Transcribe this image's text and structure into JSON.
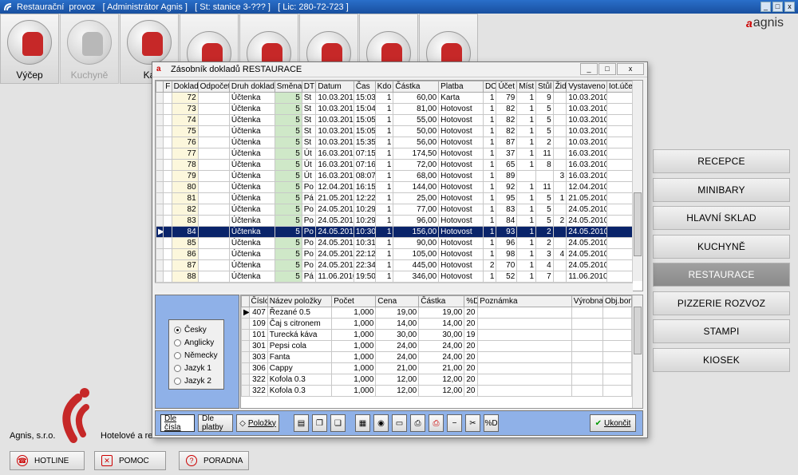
{
  "window": {
    "title": "Restaurační  provoz   [ Administrátor Agnis ]   [ St: stanice 3-??? ]   [ Lic: 280-72-723 ]",
    "btn_min": "_",
    "btn_max": "□",
    "btn_close": "x"
  },
  "brand": {
    "name": "agnis",
    "mark": "a"
  },
  "toolbar": [
    {
      "label": "Výčep",
      "name": "vycep",
      "dim": false
    },
    {
      "label": "Kuchyně",
      "name": "kuchyne",
      "dim": true
    },
    {
      "label": "Ka",
      "name": "kasa",
      "dim": false
    },
    {
      "label": "",
      "name": "sklad",
      "dim": false
    },
    {
      "label": "",
      "name": "tool5",
      "dim": false
    },
    {
      "label": "",
      "name": "tool6",
      "dim": false
    },
    {
      "label": "",
      "name": "tool7",
      "dim": false
    },
    {
      "label": "",
      "name": "tool8",
      "dim": false
    }
  ],
  "rightmenu": [
    {
      "label": "RECEPCE",
      "selected": false
    },
    {
      "label": "MINIBARY",
      "selected": false
    },
    {
      "label": "HLAVNÍ SKLAD",
      "selected": false
    },
    {
      "label": "KUCHYNĚ",
      "selected": false
    },
    {
      "label": "RESTAURACE",
      "selected": true
    },
    {
      "label": "PIZZERIE ROZVOZ",
      "selected": false
    },
    {
      "label": "STAMPI",
      "selected": false
    },
    {
      "label": "KIOSEK",
      "selected": false
    }
  ],
  "footer": {
    "company": "Agnis, s.r.o.",
    "tagline": "Hotelové a re",
    "hotline": "HOTLINE",
    "pomoc": "POMOC",
    "poradna": "PORADNA"
  },
  "dialog": {
    "title": "Zásobník dokladů  RESTAURACE",
    "columns": [
      "F",
      "Doklad",
      "Odpočet",
      "Druh dokladu",
      "Směna",
      "DT",
      "Datum",
      "Čas",
      "Kdo",
      "Částka",
      "Platba",
      "DC",
      "Účet",
      "Míst",
      "Stůl",
      "Žid",
      "Vystaveno",
      "Iot.účet"
    ],
    "rows": [
      [
        "",
        "72",
        "",
        "Účtenka",
        "5",
        "St",
        "10.03.2010",
        "15:03",
        "1",
        "60,00",
        "Karta",
        "1",
        "79",
        "1",
        "9",
        "",
        "10.03.2010",
        ""
      ],
      [
        "",
        "73",
        "",
        "Účtenka",
        "5",
        "St",
        "10.03.2010",
        "15:04",
        "1",
        "81,00",
        "Hotovost",
        "1",
        "82",
        "1",
        "5",
        "",
        "10.03.2010",
        ""
      ],
      [
        "",
        "74",
        "",
        "Účtenka",
        "5",
        "St",
        "10.03.2010",
        "15:05",
        "1",
        "55,00",
        "Hotovost",
        "1",
        "82",
        "1",
        "5",
        "",
        "10.03.2010",
        ""
      ],
      [
        "",
        "75",
        "",
        "Účtenka",
        "5",
        "St",
        "10.03.2010",
        "15:05",
        "1",
        "50,00",
        "Hotovost",
        "1",
        "82",
        "1",
        "5",
        "",
        "10.03.2010",
        ""
      ],
      [
        "",
        "76",
        "",
        "Účtenka",
        "5",
        "St",
        "10.03.2010",
        "15:35",
        "1",
        "56,00",
        "Hotovost",
        "1",
        "87",
        "1",
        "2",
        "",
        "10.03.2010",
        ""
      ],
      [
        "",
        "77",
        "",
        "Účtenka",
        "5",
        "Út",
        "16.03.2010",
        "07:15",
        "1",
        "174,50",
        "Hotovost",
        "1",
        "37",
        "1",
        "11",
        "",
        "16.03.2010",
        ""
      ],
      [
        "",
        "78",
        "",
        "Účtenka",
        "5",
        "Út",
        "16.03.2010",
        "07:16",
        "1",
        "72,00",
        "Hotovost",
        "1",
        "65",
        "1",
        "8",
        "",
        "16.03.2010",
        ""
      ],
      [
        "",
        "79",
        "",
        "Účtenka",
        "5",
        "Út",
        "16.03.2010",
        "08:07",
        "1",
        "68,00",
        "Hotovost",
        "1",
        "89",
        "",
        "",
        "3",
        "16.03.2010",
        ""
      ],
      [
        "",
        "80",
        "",
        "Účtenka",
        "5",
        "Po",
        "12.04.2010",
        "16:15",
        "1",
        "144,00",
        "Hotovost",
        "1",
        "92",
        "1",
        "11",
        "",
        "12.04.2010",
        ""
      ],
      [
        "",
        "81",
        "",
        "Účtenka",
        "5",
        "Pá",
        "21.05.2010",
        "12:22",
        "1",
        "25,00",
        "Hotovost",
        "1",
        "95",
        "1",
        "5",
        "1",
        "21.05.2010",
        ""
      ],
      [
        "",
        "82",
        "",
        "Účtenka",
        "5",
        "Po",
        "24.05.2010",
        "10:29",
        "1",
        "77,00",
        "Hotovost",
        "1",
        "83",
        "1",
        "5",
        "",
        "24.05.2010",
        ""
      ],
      [
        "",
        "83",
        "",
        "Účtenka",
        "5",
        "Po",
        "24.05.2010",
        "10:29",
        "1",
        "96,00",
        "Hotovost",
        "1",
        "84",
        "1",
        "5",
        "2",
        "24.05.2010",
        ""
      ],
      [
        "",
        "84",
        "",
        "Účtenka",
        "5",
        "Po",
        "24.05.2010",
        "10:30",
        "1",
        "156,00",
        "Hotovost",
        "1",
        "93",
        "1",
        "2",
        "",
        "24.05.2010",
        ""
      ],
      [
        "",
        "85",
        "",
        "Účtenka",
        "5",
        "Po",
        "24.05.2010",
        "10:31",
        "1",
        "90,00",
        "Hotovost",
        "1",
        "96",
        "1",
        "2",
        "",
        "24.05.2010",
        ""
      ],
      [
        "",
        "86",
        "",
        "Účtenka",
        "5",
        "Po",
        "24.05.2010",
        "22:12",
        "1",
        "105,00",
        "Hotovost",
        "1",
        "98",
        "1",
        "3",
        "4",
        "24.05.2010",
        ""
      ],
      [
        "",
        "87",
        "",
        "Účtenka",
        "5",
        "Po",
        "24.05.2010",
        "22:34",
        "1",
        "445,00",
        "Hotovost",
        "2",
        "70",
        "1",
        "4",
        "",
        "24.05.2010",
        ""
      ],
      [
        "",
        "88",
        "",
        "Účtenka",
        "5",
        "Pá",
        "11.06.2010",
        "19:50",
        "1",
        "346,00",
        "Hotovost",
        "1",
        "52",
        "1",
        "7",
        "",
        "11.06.2010",
        ""
      ]
    ],
    "selected_row": "84",
    "languages": [
      {
        "label": "Česky",
        "checked": true
      },
      {
        "label": "Anglicky",
        "checked": false
      },
      {
        "label": "Německy",
        "checked": false
      },
      {
        "label": "Jazyk 1",
        "checked": false
      },
      {
        "label": "Jazyk 2",
        "checked": false
      }
    ],
    "items_columns": [
      "Číslo",
      "Název položky",
      "Počet",
      "Cena",
      "Částka",
      "%D",
      "Poznámka",
      "Výrobna",
      "Obj.bon"
    ],
    "items": [
      [
        "407",
        "Řezané 0.5",
        "1,000",
        "19,00",
        "19,00",
        "20",
        "",
        "",
        ""
      ],
      [
        "109",
        "Čaj s citronem",
        "1,000",
        "14,00",
        "14,00",
        "20",
        "",
        "",
        ""
      ],
      [
        "101",
        "Turecká káva",
        "1,000",
        "30,00",
        "30,00",
        "19",
        "",
        "",
        ""
      ],
      [
        "301",
        "Pepsi cola",
        "1,000",
        "24,00",
        "24,00",
        "20",
        "",
        "",
        ""
      ],
      [
        "303",
        "Fanta",
        "1,000",
        "24,00",
        "24,00",
        "20",
        "",
        "",
        ""
      ],
      [
        "306",
        "Cappy",
        "1,000",
        "21,00",
        "21,00",
        "20",
        "",
        "",
        ""
      ],
      [
        "322",
        "Kofola 0.3",
        "1,000",
        "12,00",
        "12,00",
        "20",
        "",
        "",
        ""
      ],
      [
        "322",
        "Kofola 0.3",
        "1,000",
        "12,00",
        "12,00",
        "20",
        "",
        "",
        ""
      ]
    ],
    "buttons": {
      "dle_cisla": "Dle čísla",
      "dle_platby": "Dle platby",
      "polozky": "Položky",
      "ukoncit": "Ukončit",
      "pct_d": "%D"
    }
  }
}
